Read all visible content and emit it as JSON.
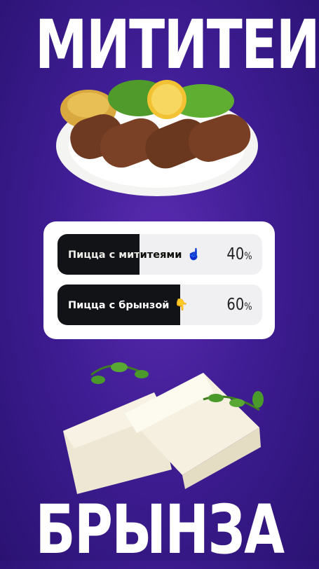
{
  "titles": {
    "top": "МИТИТЕИ",
    "bottom": "БРЫНЗА"
  },
  "poll": {
    "options": [
      {
        "label": "Пицца с мититеями",
        "emoji": "☝️",
        "percent": "40",
        "percent_sign": "%",
        "fraction": 0.4
      },
      {
        "label": "Пицца с брынзой",
        "emoji": "👇",
        "percent": "60",
        "percent_sign": "%",
        "fraction": 0.6
      }
    ]
  },
  "images": {
    "top": "mititei-plate-image",
    "bottom": "brynza-cheese-image"
  }
}
